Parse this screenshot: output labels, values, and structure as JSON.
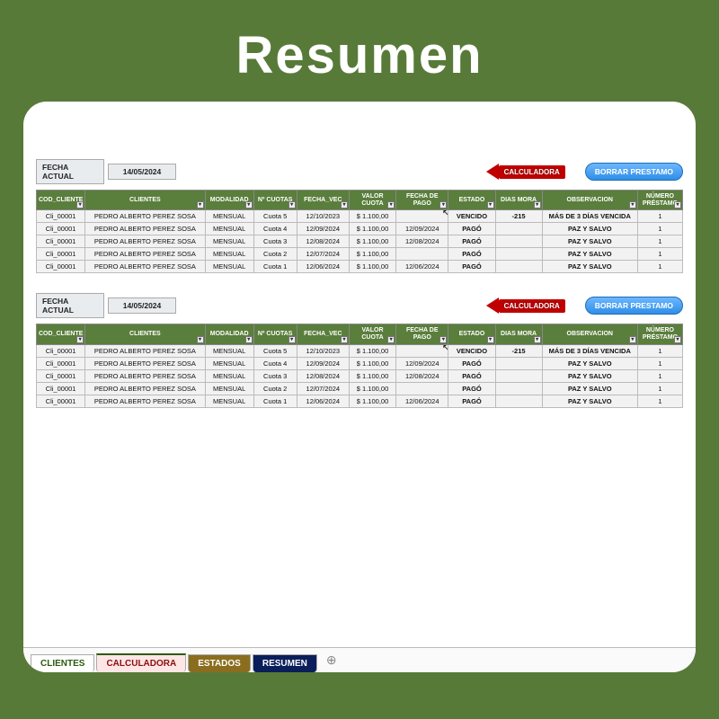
{
  "title": "Resumen",
  "fecha_actual_label": "FECHA ACTUAL",
  "fecha_actual_value": "14/05/2024",
  "calc_arrow_label": "CALCULADORA",
  "borrar_label": "BORRAR PRESTAMO",
  "headers": {
    "cod": "COD_CLIENTE",
    "cli": "CLIENTES",
    "mod": "MODALIDAD",
    "ncuo": "Nº CUOTAS",
    "fvec": "FECHA_VEC",
    "valor": "VALOR CUOTA",
    "fpago": "FECHA DE PAGO",
    "estado": "ESTADO",
    "mora": "DIAS MORA",
    "obs": "OBSERVACION",
    "num": "NÚMERO PRÉSTAMO"
  },
  "rows": [
    {
      "cod": "Cli_00001",
      "cliente": "PEDRO ALBERTO PEREZ SOSA",
      "modalidad": "MENSUAL",
      "cuota": "Cuota 5",
      "fvec": "12/10/2023",
      "valor": "$ 1.100,00",
      "fpago": "",
      "estado": "VENCIDO",
      "mora": "-215",
      "obs": "MÁS DE 3 DÍAS VENCIDA",
      "num": "1",
      "estado_cls": "estado-vencido",
      "obs_cls": "obs-red",
      "mora_cls": "mora-neg",
      "cursor": true
    },
    {
      "cod": "Cli_00001",
      "cliente": "PEDRO ALBERTO PEREZ SOSA",
      "modalidad": "MENSUAL",
      "cuota": "Cuota 4",
      "fvec": "12/09/2024",
      "valor": "$ 1.100,00",
      "fpago": "12/09/2024",
      "estado": "PAGÓ",
      "mora": "",
      "obs": "PAZ Y SALVO",
      "num": "1",
      "estado_cls": "estado-pago",
      "obs_cls": "obs-green",
      "mora_cls": "",
      "cursor": false
    },
    {
      "cod": "Cli_00001",
      "cliente": "PEDRO ALBERTO PEREZ SOSA",
      "modalidad": "MENSUAL",
      "cuota": "Cuota 3",
      "fvec": "12/08/2024",
      "valor": "$ 1.100,00",
      "fpago": "12/08/2024",
      "estado": "PAGÓ",
      "mora": "",
      "obs": "PAZ Y SALVO",
      "num": "1",
      "estado_cls": "estado-pago",
      "obs_cls": "obs-green",
      "mora_cls": "",
      "cursor": false
    },
    {
      "cod": "Cli_00001",
      "cliente": "PEDRO ALBERTO PEREZ SOSA",
      "modalidad": "MENSUAL",
      "cuota": "Cuota 2",
      "fvec": "12/07/2024",
      "valor": "$ 1.100,00",
      "fpago": "",
      "estado": "PAGÓ",
      "mora": "",
      "obs": "PAZ Y SALVO",
      "num": "1",
      "estado_cls": "estado-pago",
      "obs_cls": "obs-green",
      "mora_cls": "",
      "cursor": false
    },
    {
      "cod": "Cli_00001",
      "cliente": "PEDRO ALBERTO PEREZ SOSA",
      "modalidad": "MENSUAL",
      "cuota": "Cuota 1",
      "fvec": "12/06/2024",
      "valor": "$ 1.100,00",
      "fpago": "12/06/2024",
      "estado": "PAGÓ",
      "mora": "",
      "obs": "PAZ Y SALVO",
      "num": "1",
      "estado_cls": "estado-pago",
      "obs_cls": "obs-green",
      "mora_cls": "",
      "cursor": false
    }
  ],
  "tabs": {
    "clientes": "CLIENTES",
    "calculadora": "CALCULADORA",
    "estados": "ESTADOS",
    "resumen": "RESUMEN"
  }
}
